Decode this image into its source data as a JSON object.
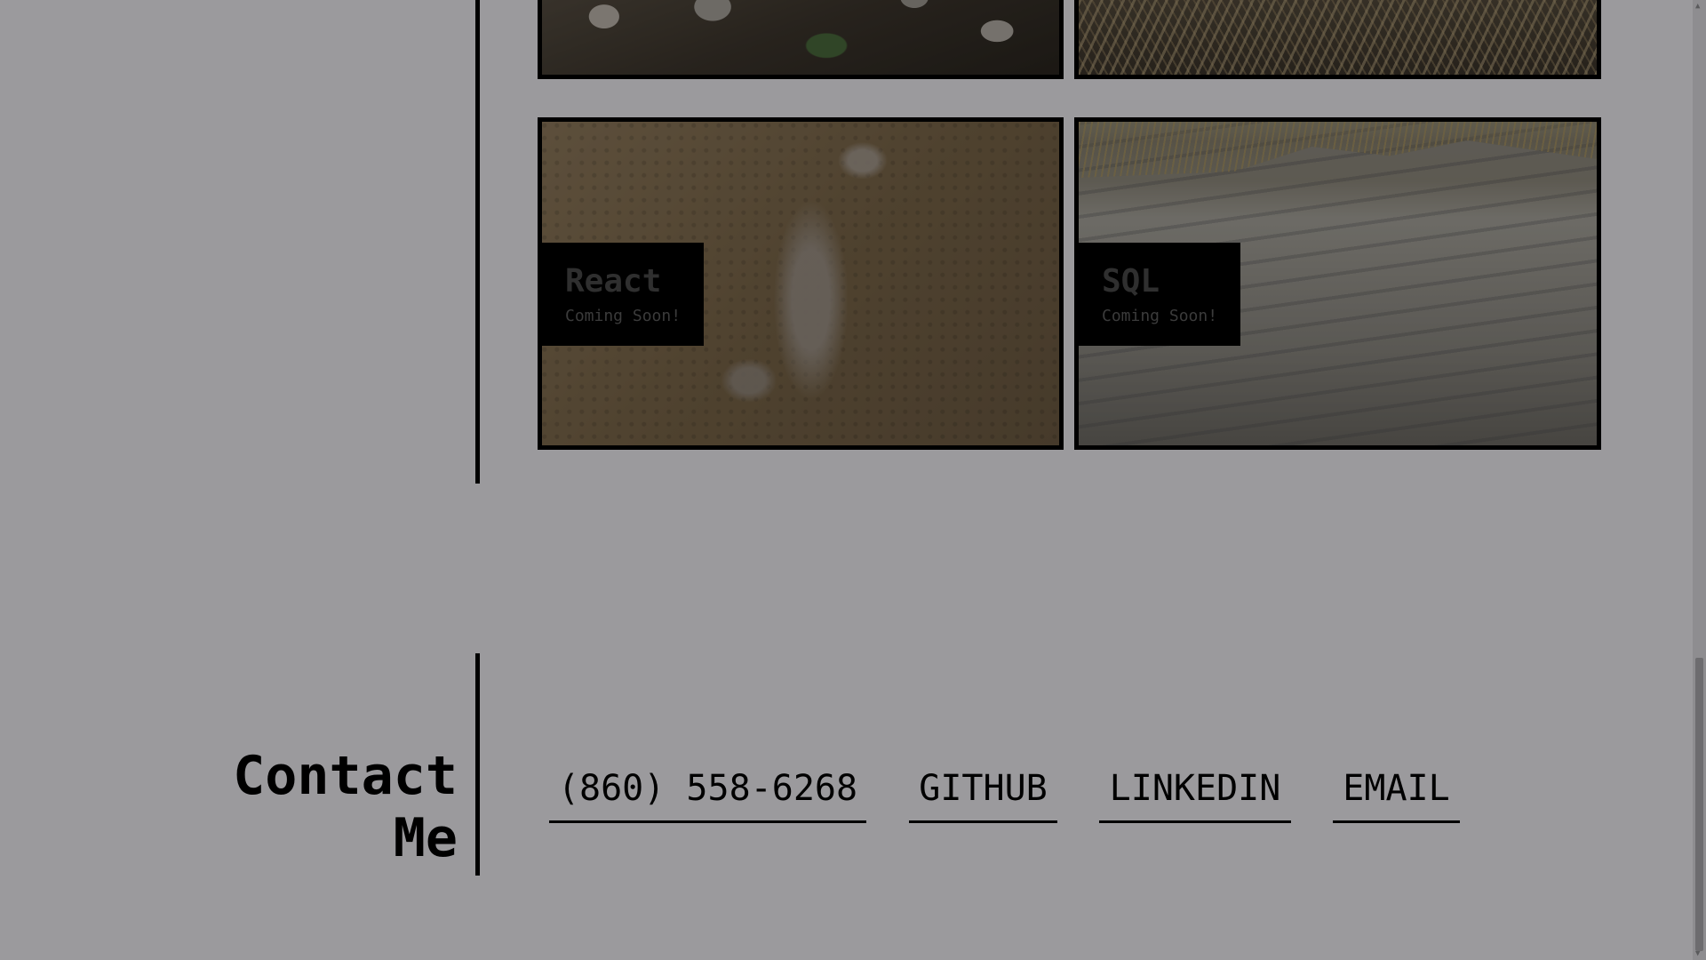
{
  "projects": [
    {
      "image": "stones-photo",
      "title": "",
      "subtitle": ""
    },
    {
      "image": "beach-grass-photo",
      "title": "",
      "subtitle": ""
    },
    {
      "image": "crab-shells-photo",
      "title": "React",
      "subtitle": "Coming Soon!"
    },
    {
      "image": "sand-dune-photo",
      "title": "SQL",
      "subtitle": "Coming Soon!"
    }
  ],
  "contact": {
    "heading": "Contact Me",
    "links": [
      "(860) 558-6268",
      "GITHUB",
      "LINKEDIN",
      "EMAIL"
    ]
  },
  "colors": {
    "background": "#9b9a9d",
    "accent": "#000000"
  }
}
